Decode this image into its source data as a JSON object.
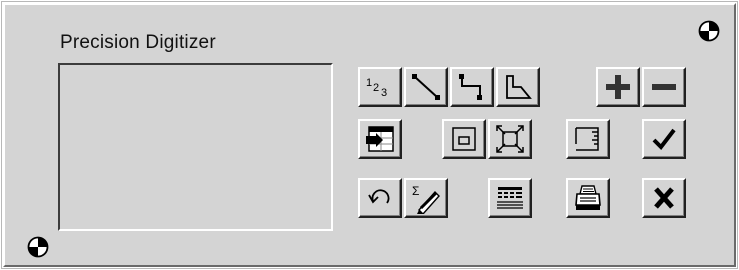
{
  "window": {
    "title": "Precision Digitizer"
  },
  "buttons": {
    "row1": [
      {
        "name": "point-numbers",
        "label": "1 2 3",
        "icon": "point-numbers-icon"
      },
      {
        "name": "line",
        "icon": "line-icon"
      },
      {
        "name": "polyline",
        "icon": "polyline-icon"
      },
      {
        "name": "polygon",
        "icon": "polygon-icon"
      },
      {
        "name": "zoom-in",
        "icon": "plus-icon"
      },
      {
        "name": "zoom-out",
        "icon": "minus-icon"
      }
    ],
    "row2": [
      {
        "name": "import",
        "icon": "import-icon"
      },
      {
        "name": "window",
        "icon": "window-icon"
      },
      {
        "name": "extents",
        "icon": "extents-icon"
      },
      {
        "name": "scale",
        "icon": "ruler-icon"
      },
      {
        "name": "accept",
        "icon": "checkmark-icon"
      }
    ],
    "row3": [
      {
        "name": "undo",
        "icon": "undo-icon"
      },
      {
        "name": "sum",
        "label": "Σ",
        "icon": "sum-pencil-icon"
      },
      {
        "name": "table",
        "icon": "table-icon"
      },
      {
        "name": "print",
        "icon": "printer-icon"
      },
      {
        "name": "cancel",
        "icon": "close-icon"
      }
    ]
  },
  "colors": {
    "panel": "#d4d4d4",
    "highlight": "#ffffff",
    "shadow": "#202020"
  }
}
